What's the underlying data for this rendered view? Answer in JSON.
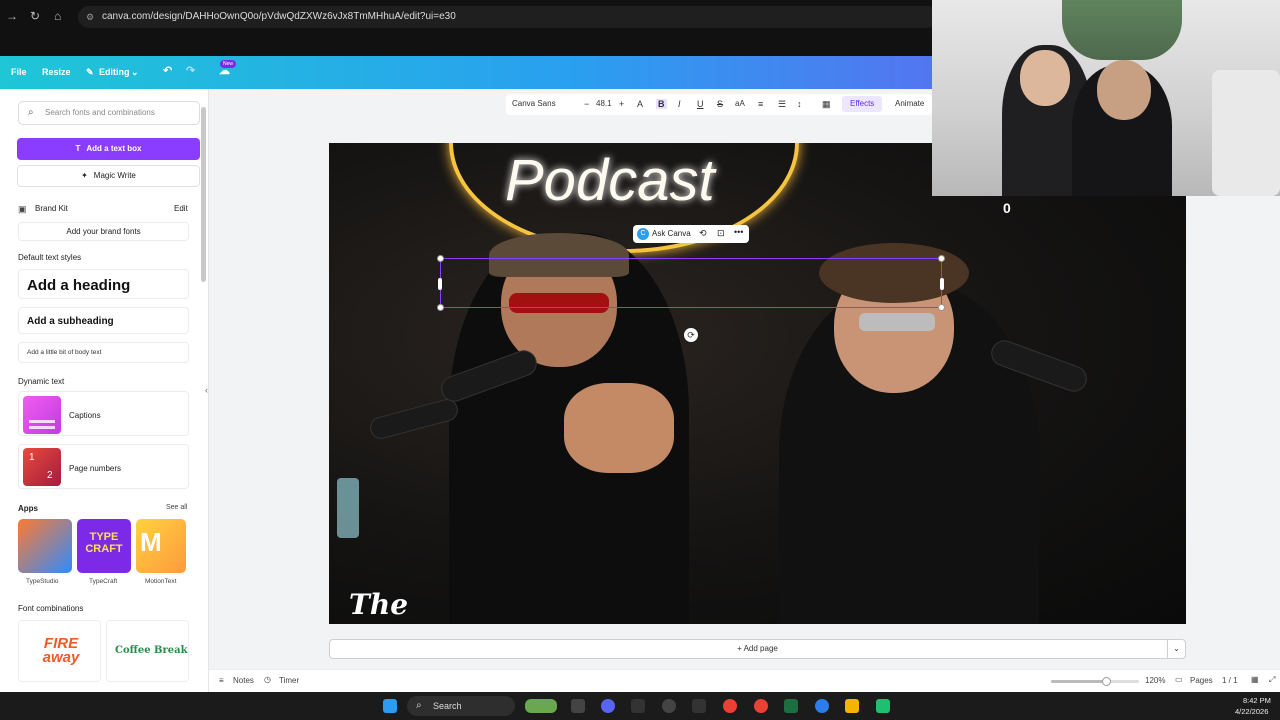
{
  "browser": {
    "url": "canva.com/design/DAHHoOwnQ0o/pVdwQdZXWz6vJx8TmMHhuA/edit?ui=e30"
  },
  "topbar": {
    "file": "File",
    "resize": "Resize",
    "editing": "Editing",
    "new_badge": "New"
  },
  "left_panel": {
    "search_placeholder": "Search fonts and combinations",
    "add_text_box": "Add a text box",
    "magic_write": "Magic Write",
    "brand_kit": "Brand Kit",
    "brand_edit": "Edit",
    "add_brand_fonts": "Add your brand fonts",
    "default_text_styles": "Default text styles",
    "heading": "Add a heading",
    "subheading": "Add a subheading",
    "body": "Add a little bit of body text",
    "dynamic_text": "Dynamic text",
    "captions": "Captions",
    "page_numbers": "Page numbers",
    "apps_title": "Apps",
    "see_all": "See all",
    "apps": [
      "TypeStudio",
      "TypeCraft",
      "MotionText"
    ],
    "font_combinations": "Font combinations",
    "combo_1": "FIRE away",
    "combo_2": "Coffee Break"
  },
  "toolbar": {
    "font": "Canva Sans",
    "size": "48.1",
    "effects": "Effects",
    "animate": "Animate"
  },
  "canvas": {
    "ask_canva": "Ask Canva",
    "podcast_sign": "Podcast",
    "the_sign": "The",
    "add_page": "+ Add page"
  },
  "webcam": {
    "counter": "0"
  },
  "bottom_bar": {
    "notes": "Notes",
    "timer": "Timer",
    "zoom": "120%",
    "pages": "Pages",
    "page_count": "1 / 1"
  },
  "taskbar": {
    "search": "Search",
    "time": "8:42 PM",
    "date": "4/22/2026"
  }
}
